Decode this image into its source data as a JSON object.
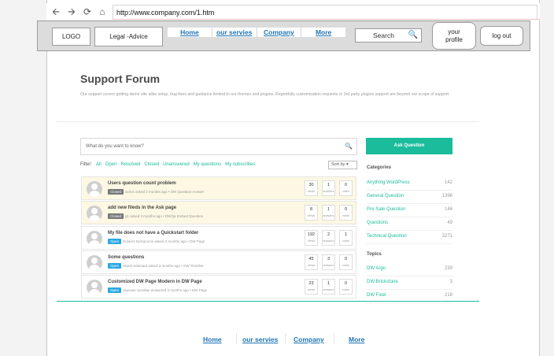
{
  "browser": {
    "url": "http://www.company.com/1.htm",
    "icons": [
      "back-arrow-icon",
      "forward-arrow-icon",
      "refresh-icon",
      "home-icon"
    ]
  },
  "header": {
    "logo": "LOGO",
    "legal": "Legal -Advice",
    "nav": [
      "Home",
      "our servies",
      "Company",
      "More"
    ],
    "search": "Search",
    "profile_line1": "your",
    "profile_line2": "profile",
    "logout": "log out"
  },
  "forum": {
    "title": "Support Forum",
    "description": "Our support covers getting demo site alike setup, bug fixes and guidance limited to our themes and plugins. Regretfully customization requests or 3rd party plugins support are beyond our scope of support.",
    "question_placeholder": "What do you want to know?",
    "ask_button": "Ask Question",
    "filter_label": "Filter:",
    "filters": [
      "All",
      "Open",
      "Resolved",
      "Closed",
      "Unanswered",
      "My questions",
      "My subscribes"
    ],
    "sort": "Sort by",
    "stat_labels": [
      "views",
      "answers",
      "votes"
    ],
    "questions": [
      {
        "title": "Users question count problem",
        "status": "Closed",
        "meta": "acrivs asked 3 months ago • DW Question Answer",
        "views": "30",
        "answers": "1",
        "votes": "0"
      },
      {
        "title": "add new fileds in the Ask page",
        "status": "Closed",
        "meta": "g1 asked 3 months ago • DWQa Embed Question",
        "views": "8",
        "answers": "1",
        "votes": "0"
      },
      {
        "title": "My file does not have a Quickstart folder",
        "status": "Open",
        "meta": "Dolores DeGaconio asked 3 months ago • DW Page",
        "views": "192",
        "answers": "2",
        "votes": "1"
      },
      {
        "title": "Some questions",
        "status": "Open",
        "meta": "Harek Salunard asked 3 months ago • DW Timeline",
        "views": "45",
        "answers": "3",
        "votes": "0"
      },
      {
        "title": "Customized DW Page Modern in DW Page",
        "status": "Open",
        "meta": "Jaycane Sundian answered 3 months ago • DW Page",
        "views": "23",
        "answers": "1",
        "votes": "0"
      }
    ],
    "categories_title": "Categories",
    "categories": [
      {
        "name": "Anything WordPress",
        "count": "142"
      },
      {
        "name": "General Question",
        "count": "1396"
      },
      {
        "name": "Pre-Sale Question",
        "count": "146"
      },
      {
        "name": "Questions",
        "count": "49"
      },
      {
        "name": "Technical Question",
        "count": "3271"
      }
    ],
    "topics_title": "Topics",
    "topics": [
      {
        "name": "DW Argo",
        "count": "239"
      },
      {
        "name": "DW Brickstone",
        "count": "3"
      },
      {
        "name": "DW Fixel",
        "count": "218"
      }
    ]
  },
  "footer": {
    "links": [
      "Home",
      "our servies",
      "Company",
      "More"
    ]
  },
  "colors": {
    "accent": "#1abc9c",
    "link": "#1f73b7",
    "closed_row": "#fcf8e3"
  }
}
